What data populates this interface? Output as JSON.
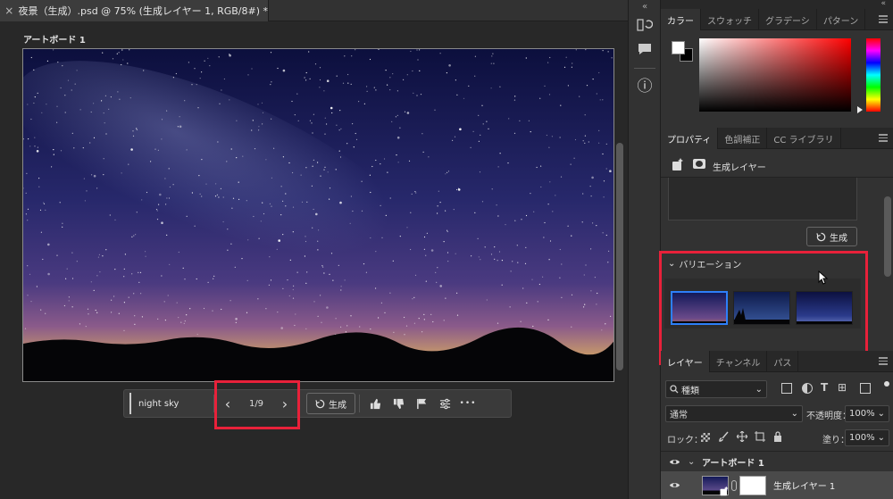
{
  "document": {
    "tab_title": "夜景（生成）.psd @ 75% (生成レイヤー 1, RGB/8#) *",
    "close_glyph": "×",
    "artboard_label": "アートボード 1"
  },
  "context_bar": {
    "prompt": "night sky",
    "variation_counter": "1/9",
    "prev_glyph": "‹",
    "next_glyph": "›",
    "generate_label": "生成",
    "more_glyph": "•••"
  },
  "color_panel": {
    "tabs": [
      "カラー",
      "スウォッチ",
      "グラデーシ",
      "パターン"
    ]
  },
  "properties_panel": {
    "tabs": [
      "プロパティ",
      "色調補正",
      "CC ライブラリ"
    ],
    "layer_type": "生成レイヤー",
    "generate_label": "生成",
    "variations_heading": "バリエーション"
  },
  "layers_panel": {
    "tabs": [
      "レイヤー",
      "チャンネル",
      "パス"
    ],
    "filter_kind": "種類",
    "filter_glyphs": [
      "T",
      "⊞"
    ],
    "blend_mode": "通常",
    "opacity_label": "不透明度：",
    "opacity_value": "100%",
    "lock_label": "ロック：",
    "fill_label": "塗り：",
    "fill_value": "100%",
    "artboard_name": "アートボード 1",
    "layer_name": "生成レイヤー 1"
  },
  "glyphs": {
    "chevron_down": "⌄",
    "collapse": "«",
    "info": "ⓘ"
  },
  "colors": {
    "highlight_red": "#e8213a",
    "selected_blue": "#2d7ff9"
  }
}
